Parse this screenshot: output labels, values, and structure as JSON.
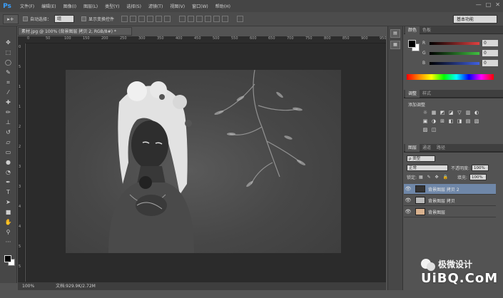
{
  "app": {
    "logo": "Ps"
  },
  "menu": [
    "文件(F)",
    "编辑(E)",
    "图像(I)",
    "图层(L)",
    "类型(Y)",
    "选择(S)",
    "滤镜(T)",
    "视图(V)",
    "窗口(W)",
    "帮助(H)"
  ],
  "window_buttons": [
    "—",
    "□",
    "✕"
  ],
  "options": {
    "tool_glyph": "▸+",
    "auto_select_label": "自动选择：",
    "auto_select_value": "组",
    "show_transform_label": "显示变换控件"
  },
  "workspace": {
    "value": "基本功能"
  },
  "document": {
    "tab_title": "素材.jpg @ 100% (背景图层 拷贝 2, RGB/8#) *",
    "zoom": "100%",
    "doc_info": "文档:929.9K/2.72M"
  },
  "ruler_top": [
    "0",
    "50",
    "100",
    "150",
    "200",
    "250",
    "300",
    "350",
    "400",
    "450",
    "500",
    "550",
    "600",
    "650",
    "700",
    "750",
    "800",
    "850",
    "900",
    "950"
  ],
  "ruler_left": [
    "0",
    "5",
    "1",
    "1",
    "2",
    "2",
    "3",
    "3",
    "4",
    "4",
    "5",
    "5"
  ],
  "color_panel": {
    "tabs": [
      "颜色",
      "色板"
    ],
    "channels": [
      {
        "label": "R",
        "value": "0",
        "color": "#e04040"
      },
      {
        "label": "G",
        "value": "0",
        "color": "#40c040"
      },
      {
        "label": "B",
        "value": "0",
        "color": "#4060e0"
      }
    ]
  },
  "adjustments_panel": {
    "tabs": [
      "调整",
      "样式"
    ],
    "title": "添加调整",
    "icons": [
      "☼",
      "▦",
      "◩",
      "◪",
      "▽",
      "▥",
      "◐",
      "▣",
      "◑",
      "⊞",
      "◧",
      "◨",
      "▤",
      "▧",
      "▨",
      "◫"
    ]
  },
  "layers_panel": {
    "tabs": [
      "图层",
      "通道",
      "路径"
    ],
    "filter_label": "ρ 类型",
    "blend_mode": "正常",
    "opacity_label": "不透明度:",
    "opacity_value": "100%",
    "lock_label": "锁定:",
    "fill_label": "填充:",
    "fill_value": "100%",
    "layers": [
      {
        "name": "背景图层 拷贝 2",
        "selected": true,
        "thumb": "#333333"
      },
      {
        "name": "背景图层 拷贝",
        "selected": false,
        "thumb": "#b9b9b9"
      },
      {
        "name": "背景图层",
        "selected": false,
        "thumb": "#d9b28f"
      }
    ]
  },
  "watermark": {
    "brand": "极微设计",
    "site": "UiBQ.CoM"
  }
}
